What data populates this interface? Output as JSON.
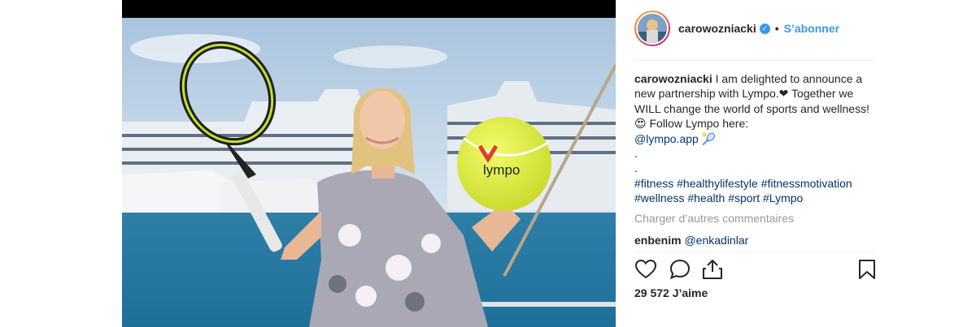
{
  "post": {
    "username": "carowozniacki",
    "separator": "•",
    "follow_label": "S’abonner",
    "caption": {
      "username": "carowozniacki",
      "text_1": "I am delighted to announce a new partnership with Lympo.❤ Together we WILL change the world of sports and wellness!😍 Follow Lympo here:",
      "mention": "@lympo.app",
      "emoji": "🎾",
      "dot_1": ".",
      "dot_2": ".",
      "hashtags": [
        "#fitness",
        "#healthylifestyle",
        "#fitnessmotivation",
        "#wellness",
        "#health",
        "#sport",
        "#Lympo"
      ]
    },
    "load_more_label": "Charger d’autres commentaires",
    "comment": {
      "username": "enbenim",
      "mention": "@enkadinlar"
    },
    "likes_label": "29 572 J’aime"
  },
  "ball_brand": "lympo",
  "icons": {
    "like": "heart-icon",
    "comment": "comment-bubble-icon",
    "share": "share-icon",
    "save": "bookmark-icon",
    "verified": "verified-badge-icon"
  },
  "colors": {
    "accent": "#3897f0",
    "link": "#003569",
    "muted": "#999999",
    "ball": "#e4f03a",
    "logo_red": "#e53935"
  }
}
